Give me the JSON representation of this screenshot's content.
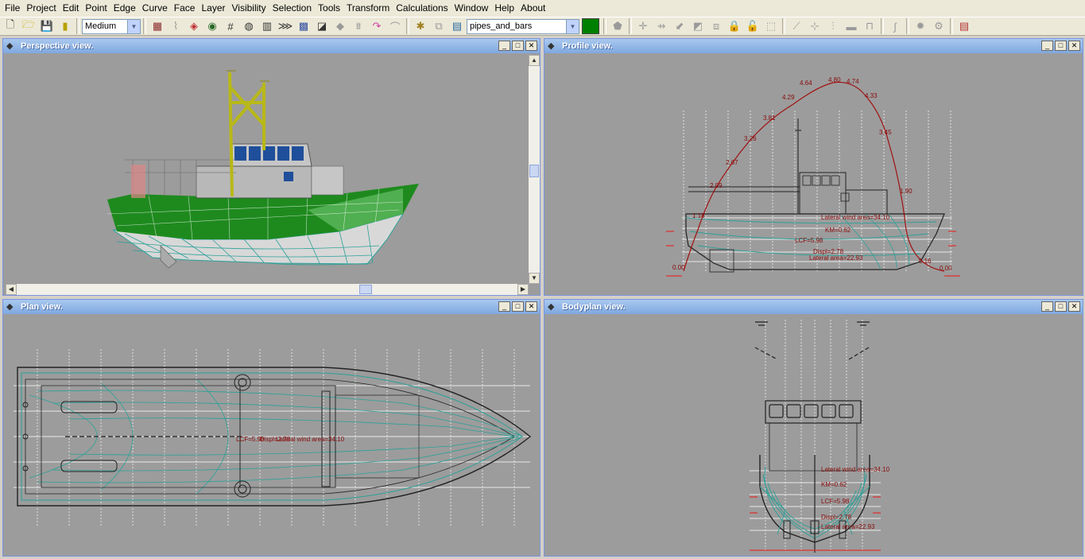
{
  "menu": [
    "File",
    "Project",
    "Edit",
    "Point",
    "Edge",
    "Curve",
    "Face",
    "Layer",
    "Visibility",
    "Selection",
    "Tools",
    "Transform",
    "Calculations",
    "Window",
    "Help",
    "About"
  ],
  "toolbar": {
    "precision_value": "Medium",
    "layer_value": "pipes_and_bars",
    "layer_color": "#008000",
    "icons": [
      "new-icon",
      "open-icon",
      "save-icon",
      "exit-icon"
    ]
  },
  "windows": {
    "perspective": {
      "title": "Perspective view."
    },
    "profile": {
      "title": "Profile view."
    },
    "plan": {
      "title": "Plan view."
    },
    "bodyplan": {
      "title": "Bodyplan view."
    }
  },
  "profile_curve_labels": [
    "0.00",
    "1.18",
    "2.09",
    "2.67",
    "3.26",
    "3.81",
    "4.29",
    "4.64",
    "4.80",
    "4.74",
    "4.33",
    "3.45",
    "1.90",
    "0.16",
    "0.00"
  ],
  "profile_annotations": [
    "Lateral wind area=34.10",
    "KM=0.62",
    "LCF=5.98",
    "Displ=2.78",
    "Lateral area=22.93"
  ],
  "plan_annotations": [
    "LCF=5.98",
    "Displ=2.78",
    "Lateral wind area=34.10"
  ],
  "bodyplan_annotations": [
    "Lateral wind area=34.10",
    "KM=0.62",
    "LCF=5.98",
    "Displ=2.78",
    "Lateral area=22.93"
  ],
  "colors": {
    "hull_green": "#1e8a1e",
    "waterline": "#2aa198",
    "curve_red": "#a01010",
    "title_bar": "#8cb3e8",
    "view_bg": "#9c9c9c"
  }
}
